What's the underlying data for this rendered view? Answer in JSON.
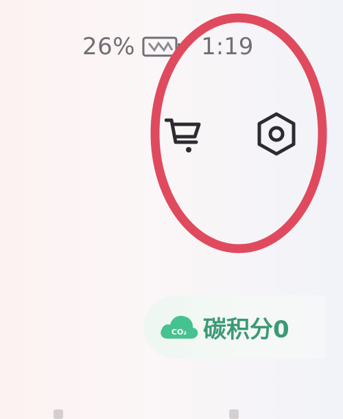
{
  "status_bar": {
    "battery_percent": "26%",
    "time": "1:19",
    "battery_icon": "battery-charging-icon"
  },
  "header": {
    "cart_icon": "cart-icon",
    "settings_icon": "settings-hexagon-icon"
  },
  "carbon": {
    "badge_icon": "co2-cloud-icon",
    "badge_icon_text": "CO₂",
    "label": "碳积分0"
  },
  "annotation": {
    "shape": "ellipse",
    "color": "#e04a5e"
  },
  "colors": {
    "accent_green": "#3a9a73",
    "icon_green": "#45c28f",
    "annotation_red": "#e04a5e"
  }
}
